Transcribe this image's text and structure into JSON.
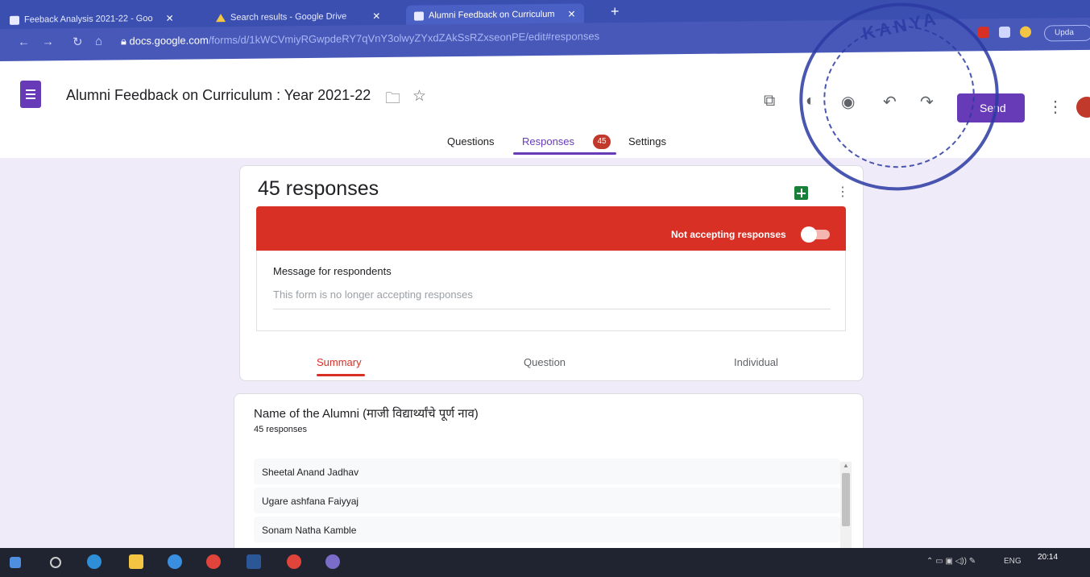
{
  "browser": {
    "tabs": [
      {
        "label": "Feeback Analysis 2021-22 - Goo",
        "icon": "sheets-tab-icon"
      },
      {
        "label": "Search results - Google Drive",
        "icon": "drive-icon"
      },
      {
        "label": "Alumni Feedback on Curriculum",
        "icon": "forms-tab-icon"
      }
    ],
    "url_host": "docs.google.com",
    "url_path": "/forms/d/1kWCVmiyRGwpdeRY7qVnY3olwyZYxdZAkSsRZxseonPE/edit#responses",
    "update_label": "Upda"
  },
  "header": {
    "title": "Alumni Feedback on Curriculum : Year 2021-22",
    "send_label": "Send"
  },
  "form_tabs": {
    "questions": "Questions",
    "responses": "Responses",
    "responses_count": "45",
    "settings": "Settings"
  },
  "summary": {
    "responses_title": "45 responses",
    "accepting_label": "Not accepting responses",
    "accepting": false,
    "message_title": "Message for respondents",
    "message_text": "This form is no longer accepting responses",
    "subtabs": [
      "Summary",
      "Question",
      "Individual"
    ]
  },
  "question": {
    "title": "Name of the Alumni (माजी विद्यार्थ्यांचे पूर्ण नाव)",
    "count": "45 responses",
    "answers": [
      "Sheetal Anand Jadhav",
      "Ugare ashfana Faiyyaj",
      "Sonam Natha Kamble"
    ]
  },
  "taskbar": {
    "lang": "ENG",
    "time": "20:14"
  },
  "stamp": {
    "text": "KANYA"
  },
  "colors": {
    "forms_purple": "#673ab7",
    "alert_red": "#d93025",
    "browser_blue": "#3a4fb0"
  }
}
